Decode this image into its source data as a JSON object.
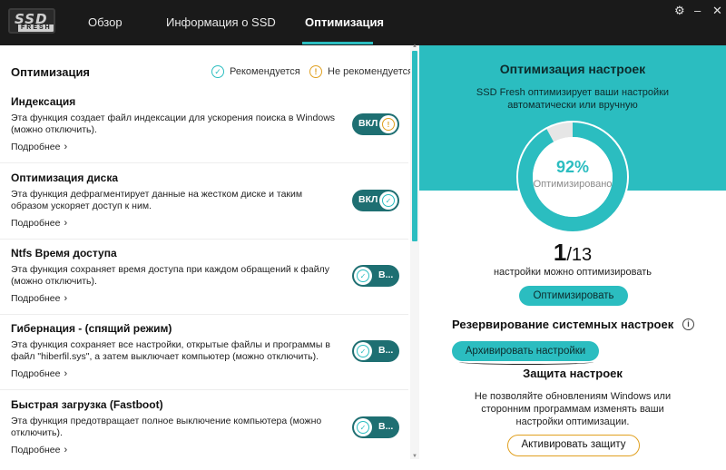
{
  "app": {
    "logo_main": "SSD",
    "logo_sub": "FRESH"
  },
  "tabs": [
    {
      "label": "Обзор"
    },
    {
      "label": "Информация о SSD"
    },
    {
      "label": "Оптимизация"
    }
  ],
  "window_icons": {
    "settings": "gear-icon",
    "close": "close-icon"
  },
  "colors": {
    "accent": "#2bbdc0",
    "toggle": "#1e6f72",
    "warning": "#e0a020"
  },
  "left": {
    "heading": "Оптимизация",
    "legend_recommended": "Рекомендуется",
    "legend_not_recommended": "Не рекомендуется",
    "items": [
      {
        "title": "Индексация",
        "desc": "Эта функция создает файл индексации для ускорения поиска в Windows (можно отключить).",
        "more": "Подробнее",
        "toggle": "ВКЛ",
        "status": "not-recommended"
      },
      {
        "title": "Оптимизация диска",
        "desc": "Эта функция дефрагментирует данные на жестком диске и таким образом ускоряет доступ к ним.",
        "more": "Подробнее",
        "toggle": "ВКЛ",
        "status": "recommended"
      },
      {
        "title": "Ntfs Время доступа",
        "desc": "Эта функция сохраняет время доступа при каждом обращений к файлу (можно отключить).",
        "more": "Подробнее",
        "toggle": "В...",
        "status": "recommended"
      },
      {
        "title": "Гибернация - (спящий режим)",
        "desc": "Эта функция сохраняет все настройки, открытые файлы и программы в файл \"hiberfil.sys\", а затем выключает компьютер (можно отключить).",
        "more": "Подробнее",
        "toggle": "В...",
        "status": "recommended"
      },
      {
        "title": "Быстрая загрузка (Fastboot)",
        "desc": "Эта функция предотвращает полное выключение компьютера (можно отключить).",
        "more": "Подробнее",
        "toggle": "В...",
        "status": "recommended"
      }
    ]
  },
  "right": {
    "title": "Оптимизация настроек",
    "subtitle": "SSD Fresh оптимизирует ваши настройки автоматически или вручную",
    "percent": "92%",
    "percent_value": 0.92,
    "percent_label": "Оптимизировано",
    "count_current": "1",
    "count_total": "/13",
    "count_label": "настройки можно оптимизировать",
    "optimize_button": "Оптимизировать",
    "backup_title": "Резервирование системных настроек",
    "archive_button": "Архивировать настройки",
    "protect_title": "Защита настроек",
    "protect_desc": "Не позволяйте обновлениям Windows или сторонним программам изменять ваши настройки оптимизации.",
    "protect_button": "Активировать защиту"
  }
}
